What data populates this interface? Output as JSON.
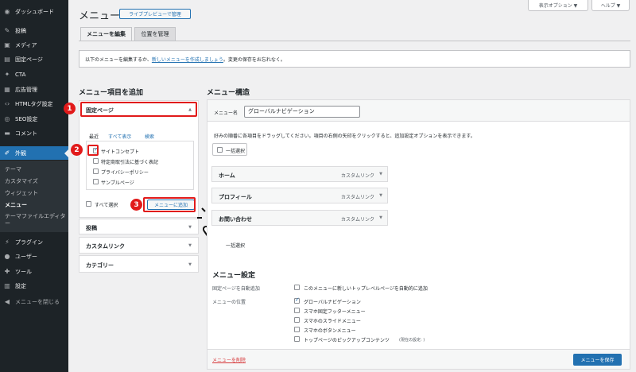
{
  "sidebar": {
    "items": [
      {
        "label": "ダッシュボード",
        "icon": "dashboard-icon",
        "glyph": "◉"
      },
      {
        "label": "投稿",
        "icon": "pin-icon",
        "glyph": "✎"
      },
      {
        "label": "メディア",
        "icon": "media-icon",
        "glyph": "▣"
      },
      {
        "label": "固定ページ",
        "icon": "page-icon",
        "glyph": "▤"
      },
      {
        "label": "CTA",
        "icon": "cta-icon",
        "glyph": "✦"
      },
      {
        "label": "広告管理",
        "icon": "ad-icon",
        "glyph": "▦"
      },
      {
        "label": "HTMLタグ設定",
        "icon": "code-icon",
        "glyph": "‹›"
      },
      {
        "label": "SEO設定",
        "icon": "seo-icon",
        "glyph": "◎"
      },
      {
        "label": "コメント",
        "icon": "comment-icon",
        "glyph": "▬"
      },
      {
        "label": "外観",
        "icon": "appearance-icon",
        "glyph": "✐"
      },
      {
        "label": "プラグイン",
        "icon": "plugin-icon",
        "glyph": "⚡"
      },
      {
        "label": "ユーザー",
        "icon": "user-icon",
        "glyph": "●"
      },
      {
        "label": "ツール",
        "icon": "tools-icon",
        "glyph": "✚"
      },
      {
        "label": "設定",
        "icon": "settings-icon",
        "glyph": "▥"
      },
      {
        "label": "メニューを閉じる",
        "icon": "collapse-icon",
        "glyph": "◀"
      }
    ],
    "submenu": [
      "テーマ",
      "カスタマイズ",
      "ウィジェット",
      "メニュー",
      "テーマファイルエディター"
    ]
  },
  "header": {
    "title": "メニュー",
    "live_preview": "ライブプレビューで管理",
    "screen_options": "表示オプション ▼",
    "help": "ヘルプ ▼"
  },
  "tabs": [
    "メニューを編集",
    "位置を管理"
  ],
  "notice": {
    "before": "以下のメニューを編集するか、",
    "link": "新しいメニューを作成しましょう",
    "after": "。変更の保存をお忘れなく。"
  },
  "add_items": {
    "heading": "メニュー項目を追加",
    "pages_title": "固定ページ",
    "subtabs": [
      "最近",
      "すべて表示",
      "検索"
    ],
    "pages": [
      {
        "label": "サイトコンセプト",
        "checked": true
      },
      {
        "label": "特定商取引法に基づく表記",
        "checked": false
      },
      {
        "label": "プライバシーポリシー",
        "checked": false
      },
      {
        "label": "サンプルページ",
        "checked": false
      }
    ],
    "select_all": "すべて選択",
    "add_button": "メニューに追加",
    "sections": [
      "投稿",
      "カスタムリンク",
      "カテゴリー"
    ]
  },
  "structure": {
    "heading": "メニュー構造",
    "name_label": "メニュー名",
    "name_value": "グローバルナビゲーション",
    "instructions": "好みの順番に各項目をドラッグしてください。項目の右側の矢印をクリックすると、追加設定オプションを表示できます。",
    "bulk_select": "一括選択",
    "items": [
      {
        "title": "ホーム",
        "type": "カスタムリンク"
      },
      {
        "title": "プロフィール",
        "type": "カスタムリンク"
      },
      {
        "title": "お問い合わせ",
        "type": "カスタムリンク"
      }
    ]
  },
  "settings": {
    "heading": "メニュー設定",
    "auto_add_label": "固定ページを自動追加",
    "auto_add_option": "このメニューに新しいトップレベルページを自動的に追加",
    "location_label": "メニューの位置",
    "locations": [
      {
        "label": "グローバルナビゲーション",
        "checked": true
      },
      {
        "label": "スマホ固定フッターメニュー",
        "checked": false
      },
      {
        "label": "スマホのスライドメニュー",
        "checked": false
      },
      {
        "label": "スマホのボタンメニュー",
        "checked": false
      },
      {
        "label": "トップページのピックアップコンテンツ",
        "note": "(現在の設定: )",
        "checked": false
      }
    ],
    "delete_link": "メニューを削除",
    "save_button": "メニューを保存"
  },
  "annotations": [
    "1",
    "2",
    "3"
  ],
  "colors": {
    "accent": "#2271b1",
    "highlight": "#e11a1a",
    "sidebar": "#1d2327"
  }
}
